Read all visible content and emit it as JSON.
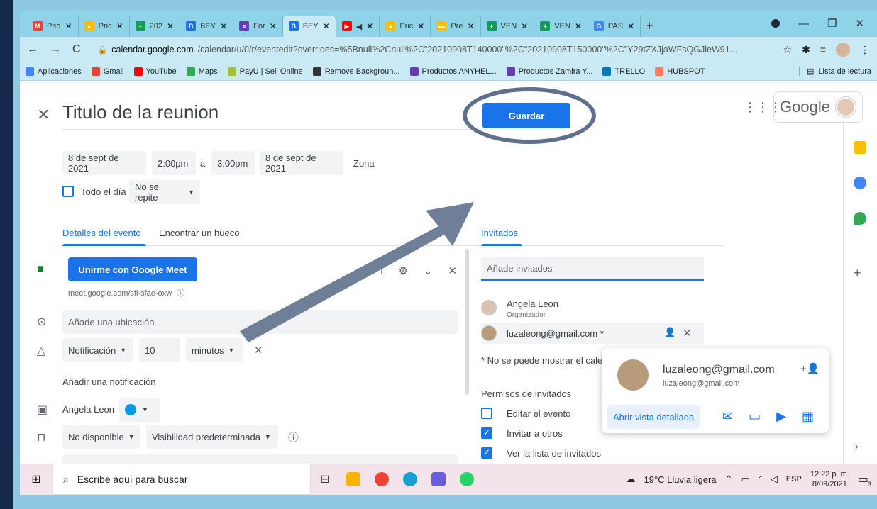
{
  "browser": {
    "tabs": [
      {
        "label": "Ped",
        "color": "#ea4335",
        "glyph": "M"
      },
      {
        "label": "Pric",
        "color": "#fbbc04",
        "glyph": "▲"
      },
      {
        "label": "202",
        "color": "#0f9d58",
        "glyph": "+"
      },
      {
        "label": "BEY",
        "color": "#1a73e8",
        "glyph": "B"
      },
      {
        "label": "For",
        "color": "#673ab7",
        "glyph": "≡"
      },
      {
        "label": "BEY",
        "color": "#1a73e8",
        "glyph": "B",
        "active": true
      },
      {
        "label": "◀",
        "color": "#ff0000",
        "glyph": "▶"
      },
      {
        "label": "Pric",
        "color": "#fbbc04",
        "glyph": "▲"
      },
      {
        "label": "Pre",
        "color": "#fbbc04",
        "glyph": "▬"
      },
      {
        "label": "VEN",
        "color": "#0f9d58",
        "glyph": "+"
      },
      {
        "label": "VEN",
        "color": "#0f9d58",
        "glyph": "+"
      },
      {
        "label": "PAS",
        "color": "#4285f4",
        "glyph": "G"
      }
    ],
    "url_host": "calendar.google.com",
    "url_rest": "/calendar/u/0/r/eventedit?overrides=%5Bnull%2Cnull%2C\"20210908T140000\"%2C\"20210908T150000\"%2C\"Y29tZXJjaWFsQGJleW91...",
    "bookmarks": [
      {
        "label": "Aplicaciones",
        "color": "#4285f4"
      },
      {
        "label": "Gmail",
        "color": "#ea4335"
      },
      {
        "label": "YouTube",
        "color": "#ff0000"
      },
      {
        "label": "Maps",
        "color": "#34a853"
      },
      {
        "label": "PayU | Sell Online",
        "color": "#a2c037"
      },
      {
        "label": "Remove Backgroun...",
        "color": "#333333"
      },
      {
        "label": "Productos ANYHEL...",
        "color": "#673ab7"
      },
      {
        "label": "Productos Zamira Y...",
        "color": "#673ab7"
      },
      {
        "label": "TRELLO",
        "color": "#0079bf"
      },
      {
        "label": "HUBSPOT",
        "color": "#ff7a59"
      }
    ],
    "reading_list": "Lista de lectura"
  },
  "event": {
    "title": "Titulo de la reunion",
    "save_label": "Guardar",
    "start_date": "8 de sept de 2021",
    "start_time": "2:00pm",
    "sep": "a",
    "end_time": "3:00pm",
    "end_date": "8 de sept de 2021",
    "timezone_partial": "Zona",
    "all_day": "Todo el día",
    "repeat": "No se repite",
    "tab_details": "Detalles del evento",
    "tab_find": "Encontrar un hueco",
    "meet_button": "Unirme con Google Meet",
    "meet_link": "meet.google.com/sfi-sfae-oxw",
    "location_placeholder": "Añade una ubicación",
    "notification_type": "Notificación",
    "notification_value": "10",
    "notification_unit": "minutos",
    "add_notification": "Añadir una notificación",
    "calendar_owner": "Angela Leon",
    "availability": "No disponible",
    "visibility": "Visibilidad predeterminada"
  },
  "guests": {
    "tab": "Invitados",
    "placeholder": "Añade invitados",
    "organizer_name": "Angela Leon",
    "organizer_role": "Organizador",
    "guest_email": "luzaleong@gmail.com *",
    "note": "* No se puede mostrar el cale",
    "permissions_title": "Permisos de invitados",
    "perm_edit": "Editar el evento",
    "perm_invite": "Invitar a otros",
    "perm_list": "Ver la lista de invitados"
  },
  "popup": {
    "email": "luzaleong@gmail.com",
    "sub": "luzaleong@gmail.com",
    "detail_button": "Abrir vista detallada"
  },
  "google": {
    "logo": "Google"
  },
  "taskbar": {
    "search": "Escribe aquí para buscar",
    "weather": "19°C  Lluvia ligera",
    "lang": "ESP",
    "time": "12:22 p. m.",
    "date": "8/09/2021",
    "notif_count": "3"
  }
}
